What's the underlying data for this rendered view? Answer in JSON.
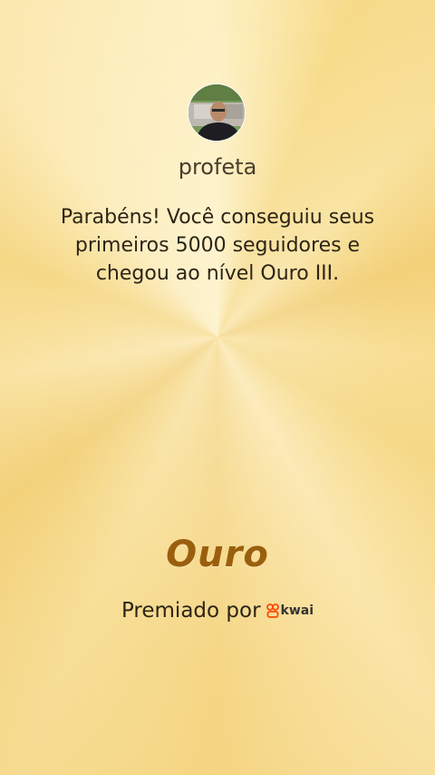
{
  "profile": {
    "username": "profeta",
    "avatar_icon": "user-photo-avatar"
  },
  "message": {
    "text": "Parabéns! Você conseguiu seus primeiros 5000 seguidores e chegou ao nível Ouro III."
  },
  "achievement": {
    "level_name": "Ouro"
  },
  "award": {
    "label": "Premiado por",
    "brand_name": "kwai",
    "brand_icon": "kwai-logo-icon",
    "brand_color": "#ff4906"
  },
  "theme": {
    "background": "#f7dc8e",
    "level_color": "#9a5f0e",
    "text_color": "#2d2416"
  }
}
